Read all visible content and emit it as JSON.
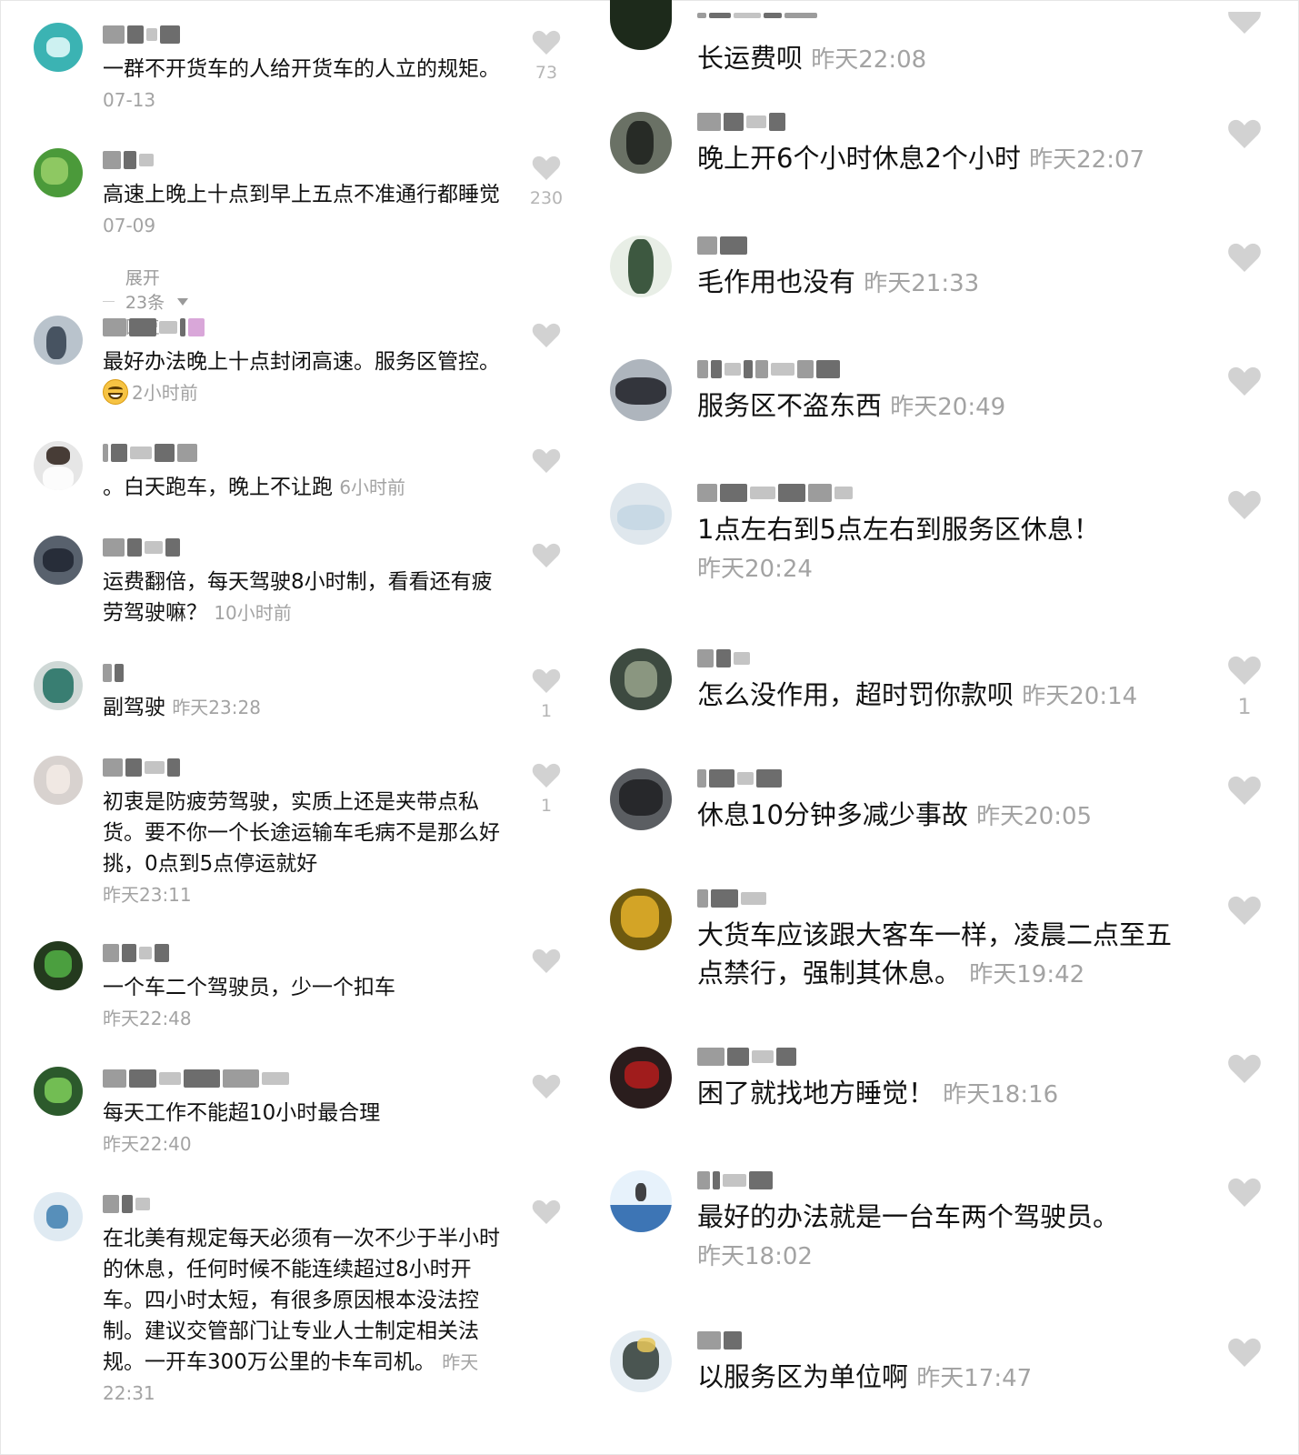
{
  "left": {
    "comments": [
      {
        "text": "一群不开货车的人给开货车的人立的规矩。",
        "time": "07-13",
        "likes": "73"
      },
      {
        "text": "高速上晚上十点到早上五点不准通行都睡觉",
        "time": "07-09",
        "likes": "230"
      },
      {
        "text": "最好办法晚上十点封闭高速。服务区管控。",
        "time": "2小时前",
        "likes": ""
      },
      {
        "text": "。白天跑车，晚上不让跑",
        "time": "6小时前",
        "likes": ""
      },
      {
        "text": "运费翻倍，每天驾驶8小时制，看看还有疲劳驾驶嘛？",
        "time": "10小时前",
        "likes": ""
      },
      {
        "text": "副驾驶",
        "time": "昨天23:28",
        "likes": "1"
      },
      {
        "text": "初衷是防疲劳驾驶，实质上还是夹带点私货。要不你一个长途运输车毛病不是那么好挑，0点到5点停运就好",
        "time": "昨天23:11",
        "likes": "1"
      },
      {
        "text": "一个车二个驾驶员，少一个扣车",
        "time": "昨天22:48",
        "likes": ""
      },
      {
        "text": "每天工作不能超10小时最合理",
        "time": "昨天22:40",
        "likes": ""
      },
      {
        "text": "在北美有规定每天必须有一次不少于半小时的休息，任何时候不能连续超过8小时开车。四小时太短，有很多原因根本没法控制。建议交管部门让专业人士制定相关法规。一开车300万公里的卡车司机。",
        "time": "昨天22:31",
        "likes": ""
      }
    ],
    "expand_label": "展开23条回复"
  },
  "right": {
    "comments": [
      {
        "text": "长运费呗",
        "time": "昨天22:08",
        "likes": ""
      },
      {
        "text": "晚上开6个小时休息2个小时",
        "time": "昨天22:07",
        "likes": ""
      },
      {
        "text": "毛作用也没有",
        "time": "昨天21:33",
        "likes": ""
      },
      {
        "text": "服务区不盗东西",
        "time": "昨天20:49",
        "likes": ""
      },
      {
        "text": "1点左右到5点左右到服务区休息！",
        "time": "昨天20:24",
        "likes": ""
      },
      {
        "text": "怎么没作用，超时罚你款呗",
        "time": "昨天20:14",
        "likes": "1"
      },
      {
        "text": "休息10分钟多减少事故",
        "time": "昨天20:05",
        "likes": ""
      },
      {
        "text": "大货车应该跟大客车一样，凌晨二点至五点禁行，强制其休息。",
        "time": "昨天19:42",
        "likes": ""
      },
      {
        "text": "困了就找地方睡觉！",
        "time": "昨天18:16",
        "likes": ""
      },
      {
        "text": "最好的办法就是一台车两个驾驶员。",
        "time": "昨天18:02",
        "likes": ""
      },
      {
        "text": "以服务区为单位啊",
        "time": "昨天17:47",
        "likes": ""
      }
    ]
  },
  "colors": {
    "time": "#a3a3a3",
    "heart": "#d2d2d2",
    "text": "#111111"
  },
  "icons": {
    "like": "heart-icon",
    "expand": "triangle-down-icon",
    "emoji": "grin-emoji-icon"
  }
}
